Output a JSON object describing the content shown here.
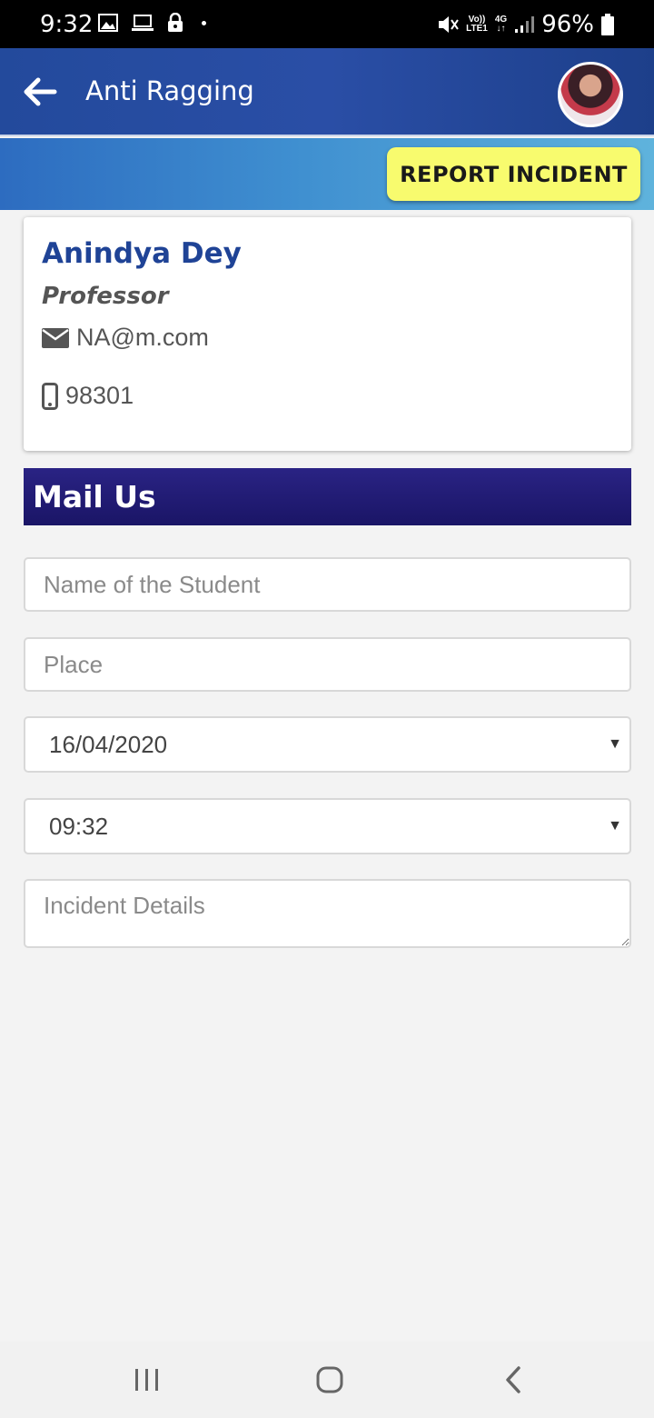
{
  "status_bar": {
    "time": "9:32",
    "network_top": "Vo))",
    "network_bottom": "LTE1",
    "net_type": "4G",
    "battery": "96%",
    "icons": [
      "image-icon",
      "laptop-icon",
      "lock-icon",
      "mute-icon",
      "signal-icon",
      "battery-icon"
    ]
  },
  "app_bar": {
    "title": "Anti Ragging"
  },
  "banner": {
    "report_button": "REPORT INCIDENT"
  },
  "contact": {
    "name": "Anindya Dey",
    "role": "Professor",
    "email": "NA@m.com",
    "phone": "98301"
  },
  "mail_section": {
    "title": "Mail Us"
  },
  "form": {
    "student_name": {
      "value": "",
      "placeholder": "Name of the Student"
    },
    "place": {
      "value": "",
      "placeholder": "Place"
    },
    "date": {
      "value": "16/04/2020"
    },
    "time": {
      "value": "09:32"
    },
    "details": {
      "value": "",
      "placeholder": "Incident Details"
    }
  },
  "colors": {
    "app_bar": "#2a4ea6",
    "report_button": "#f8fb6e",
    "name_text": "#1f4396",
    "mail_header": "#1a1566"
  }
}
